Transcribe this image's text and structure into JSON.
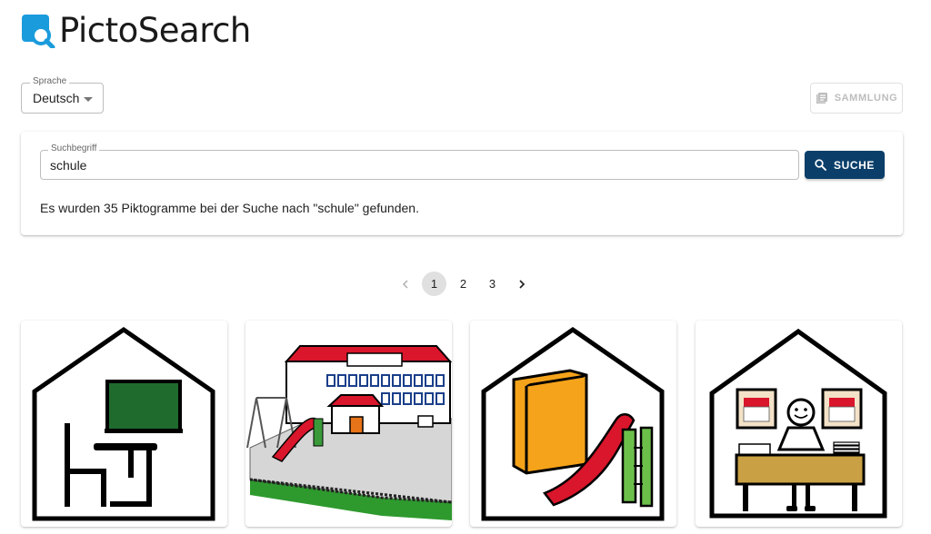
{
  "app": {
    "title": "PictoSearch"
  },
  "language": {
    "legend": "Sprache",
    "selected": "Deutsch"
  },
  "collection": {
    "label": "SAMMLUNG"
  },
  "search": {
    "legend": "Suchbegriff",
    "value": "schule",
    "button_label": "SUCHE",
    "result_text": "Es wurden 35 Piktogramme bei der Suche nach \"schule\" gefunden."
  },
  "pagination": {
    "pages": [
      "1",
      "2",
      "3"
    ],
    "current": "1"
  },
  "results": [
    {
      "subject": "school-house-desk-board"
    },
    {
      "subject": "school-building-playground"
    },
    {
      "subject": "school-house-book-slide"
    },
    {
      "subject": "school-house-teacher"
    }
  ],
  "colors": {
    "brand": "#1a9bdc",
    "primary_button": "#0b3f6a"
  }
}
